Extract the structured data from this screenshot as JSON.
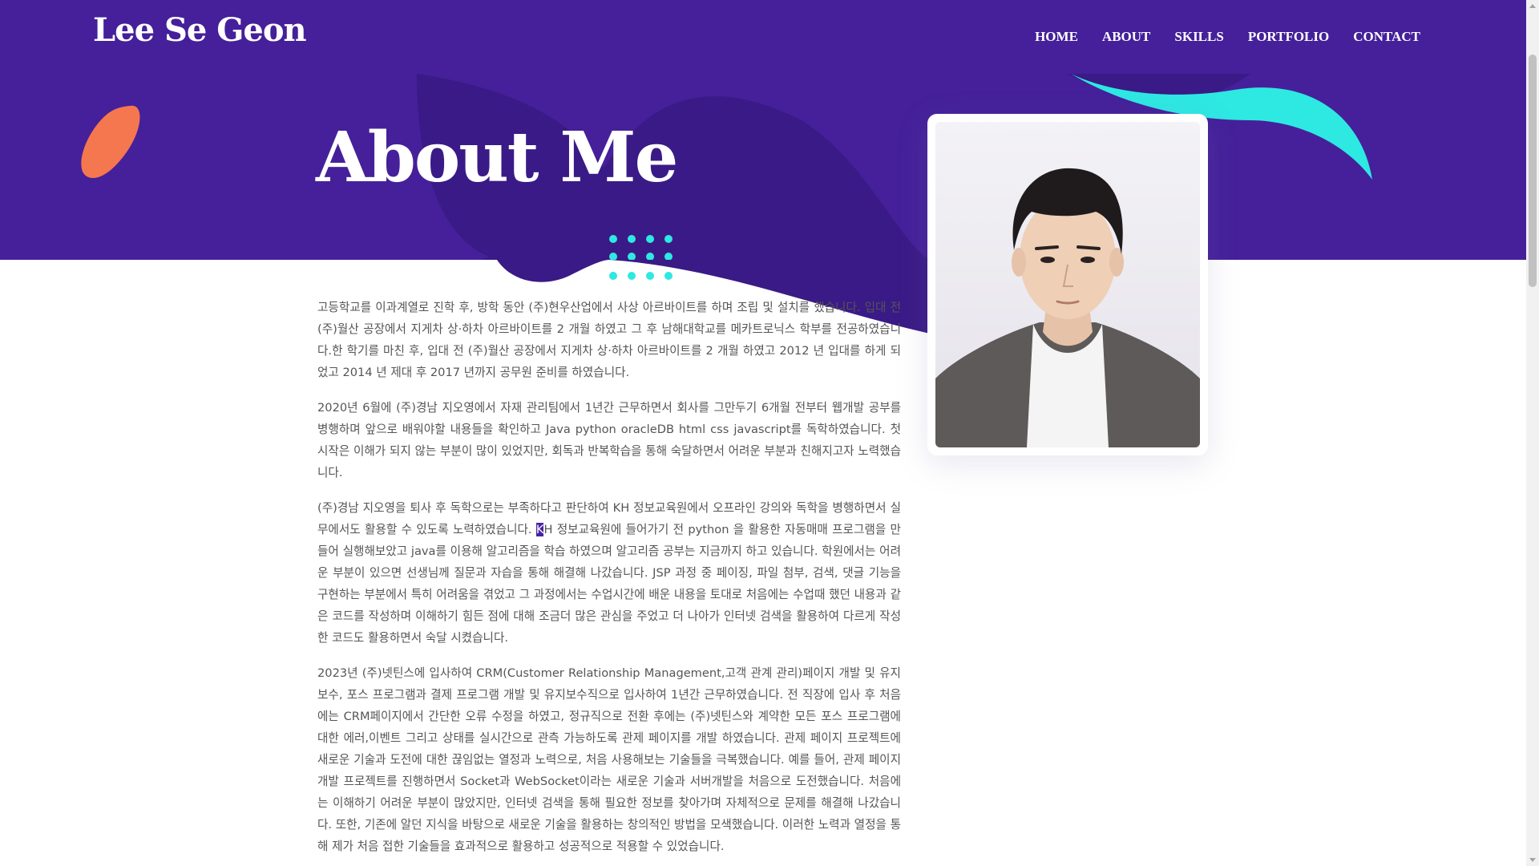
{
  "brand": "Lee Se Geon",
  "nav": [
    "HOME",
    "ABOUT",
    "SKILLS",
    "PORTFOLIO",
    "CONTACT"
  ],
  "hero": {
    "title": "About Me"
  },
  "colors": {
    "primary": "#45209a",
    "dark": "#3a1a86",
    "accent": "#2ee8e2",
    "coral": "#f5774f"
  },
  "about": {
    "p1": "고등학교를 이과계열로 진학 후, 방학 동안 (주)현우산업에서 사상 아르바이트를 하며 조립 및 설치를 했습니다. 입대 전 (주)월산 공장에서 지게차 상·하차 아르바이트를 2 개월 하였고 그 후 남해대학교를 메카트로닉스 학부를 전공하였습니다.한 학기를 마친 후, 입대 전 (주)월산 공장에서 지게차 상·하차 아르바이트를 2 개월 하였고 2012 년 입대를 하게 되었고 2014 년 제대 후 2017 년까지 공무원 준비를 하였습니다.",
    "p2": "2020년 6월에 (주)경남 지오영에서 자재 관리팀에서 1년간 근무하면서 회사를 그만두기 6개월 전부터 웹개발 공부를 병행하며 앞으로 배워야할 내용들을 확인하고 Java python oracleDB html css javascript를 독학하였습니다. 첫 시작은 이해가 되지 않는 부분이 많이 있었지만, 회독과 반복학습을 통해 숙달하면서 어려운 부분과 친해지고자 노력했습니다.",
    "p3a": "(주)경남 지오영을 퇴사 후 독학으로는 부족하다고 판단하여 KH 정보교육원에서 오프라인 강의와 독학을 병행하면서 실무에서도 활용할 수 있도록 노력하였습니다. ",
    "p3hl": "K",
    "p3b": "H 정보교육원에 들어가기 전 python 을 활용한 자동매매 프로그램을 만들어 실행해보았고 java를 이용해 알고리즘을 학습 하였으며 알고리즘 공부는 지금까지 하고 있습니다. 학원에서는 어려운 부분이 있으면 선생님께 질문과 자습을 통해 해결해 나갔습니다. JSP 과정 중 페이징, 파일 첨부, 검색, 댓글 기능을 구현하는 부분에서 특히 어려움을 겪었고 그 과정에서는 수업시간에 배운 내용을 토대로 처음에는 수업때 했던 내용과 같은 코드를 작성하며 이해하기 힘든 점에 대해 조금더 많은 관심을 주었고 더 나아가 인터넷 검색을 활용하여 다르게 작성한 코드도 활용하면서 숙달 시켰습니다.",
    "p4": "2023년 (주)넷틴스에 입사하여 CRM(Customer Relationship Management,고객 관계 관리)페이지 개발 및 유지보수, 포스 프로그램과 결제 프로그램 개발 및 유지보수직으로 입사하여 1년간 근무하였습니다. 전 직장에 입사 후 처음에는 CRM페이지에서 간단한 오류 수정을 하였고, 정규직으로 전환 후에는 (주)넷틴스와 계약한 모든 포스 프로그램에 대한 에러,이벤트 그리고 상태를 실시간으로 관측 가능하도록 관제 페이지를 개발 하였습니다. 관제 페이지 프로젝트에 새로운 기술과 도전에 대한 끊임없는 열정과 노력으로, 처음 사용해보는 기술들을 극복했습니다. 예를 들어, 관제 페이지 개발 프로젝트를 진행하면서 Socket과 WebSocket이라는 새로운 기술과 서버개발을 처음으로 도전했습니다. 처음에는 이해하기 어려운 부분이 많았지만, 인터넷 검색을 통해 필요한 정보를 찾아가며 자체적으로 문제를 해결해 나갔습니다. 또한, 기존에 알던 지식을 바탕으로 새로운 기술을 활용하는 창의적인 방법을 모색했습니다. 이러한 노력과 열정을 통해 제가 처음 접한 기술들을 효과적으로 활용하고 성공적으로 적용할 수 있었습니다."
  }
}
